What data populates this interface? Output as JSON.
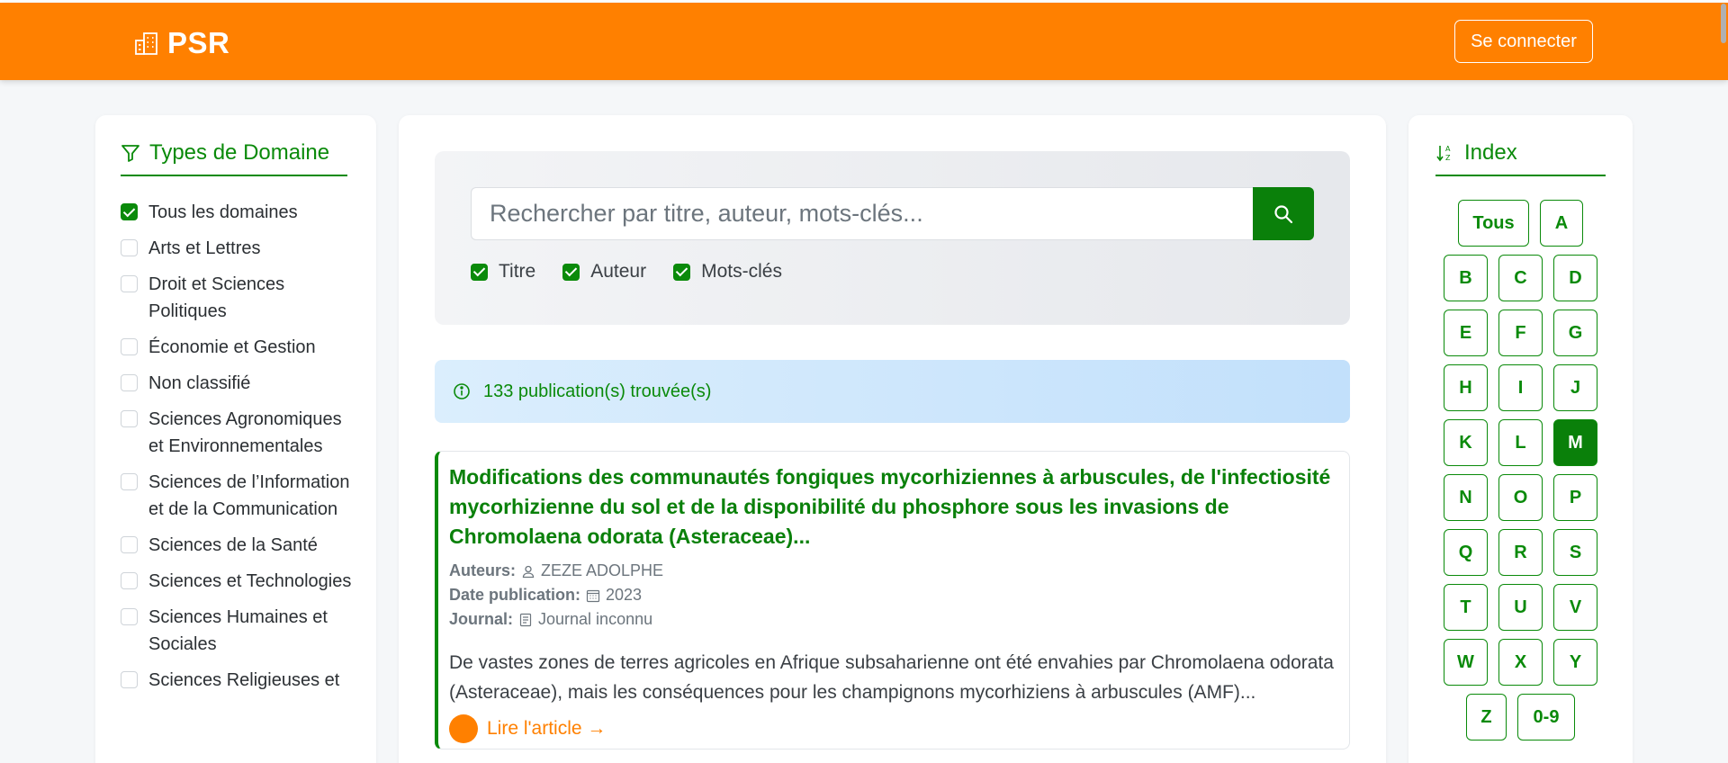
{
  "navbar": {
    "brand": "PSR",
    "login_label": "Se connecter"
  },
  "domains": {
    "title": "Types de Domaine",
    "items": [
      {
        "label": "Tous les domaines",
        "checked": true
      },
      {
        "label": "Arts et Lettres",
        "checked": false
      },
      {
        "label": "Droit et Sciences Politiques",
        "checked": false
      },
      {
        "label": "Économie et Gestion",
        "checked": false
      },
      {
        "label": "Non classifié",
        "checked": false
      },
      {
        "label": "Sciences Agronomiques et Environnementales",
        "checked": false
      },
      {
        "label": "Sciences de l’Information et de la Communication",
        "checked": false
      },
      {
        "label": "Sciences de la Santé",
        "checked": false
      },
      {
        "label": "Sciences et Technologies",
        "checked": false
      },
      {
        "label": "Sciences Humaines et Sociales",
        "checked": false
      },
      {
        "label": "Sciences Religieuses et",
        "checked": false
      }
    ]
  },
  "search": {
    "placeholder": "Rechercher par titre, auteur, mots-clés...",
    "options": [
      {
        "label": "Titre",
        "checked": true
      },
      {
        "label": "Auteur",
        "checked": true
      },
      {
        "label": "Mots-clés",
        "checked": true
      }
    ]
  },
  "results": {
    "count_text": "133 publication(s) trouvée(s)"
  },
  "publication": {
    "title": "Modifications des communautés fongiques mycorhiziennes à arbuscules, de l'infectiosité mycorhizienne du sol et de la disponibilité du phosphore sous les invasions de Chromolaena odorata (Asteraceae)...",
    "authors_label": "Auteurs:",
    "authors": "ZEZE ADOLPHE",
    "date_label": "Date publication:",
    "date": "2023",
    "journal_label": "Journal:",
    "journal": "Journal inconnu",
    "abstract": "De vastes zones de terres agricoles en Afrique subsaharienne ont été envahies par Chromolaena odorata (Asteraceae), mais les conséquences pour les champignons mycorhiziens à arbuscules (AMF)...",
    "read_label": "Lire l'article →"
  },
  "index": {
    "title": "Index",
    "active": "M",
    "rows": [
      [
        "Tous",
        "A"
      ],
      [
        "B",
        "C",
        "D"
      ],
      [
        "E",
        "F",
        "G"
      ],
      [
        "H",
        "I",
        "J"
      ],
      [
        "K",
        "L",
        "M"
      ],
      [
        "N",
        "O",
        "P"
      ],
      [
        "Q",
        "R",
        "S"
      ],
      [
        "T",
        "U",
        "V"
      ],
      [
        "W",
        "X",
        "Y"
      ],
      [
        "Z",
        "0-9"
      ]
    ]
  },
  "colors": {
    "brand_orange": "#ff8000",
    "accent_green": "#0a800a",
    "info_blue": "#c2e0fb"
  }
}
